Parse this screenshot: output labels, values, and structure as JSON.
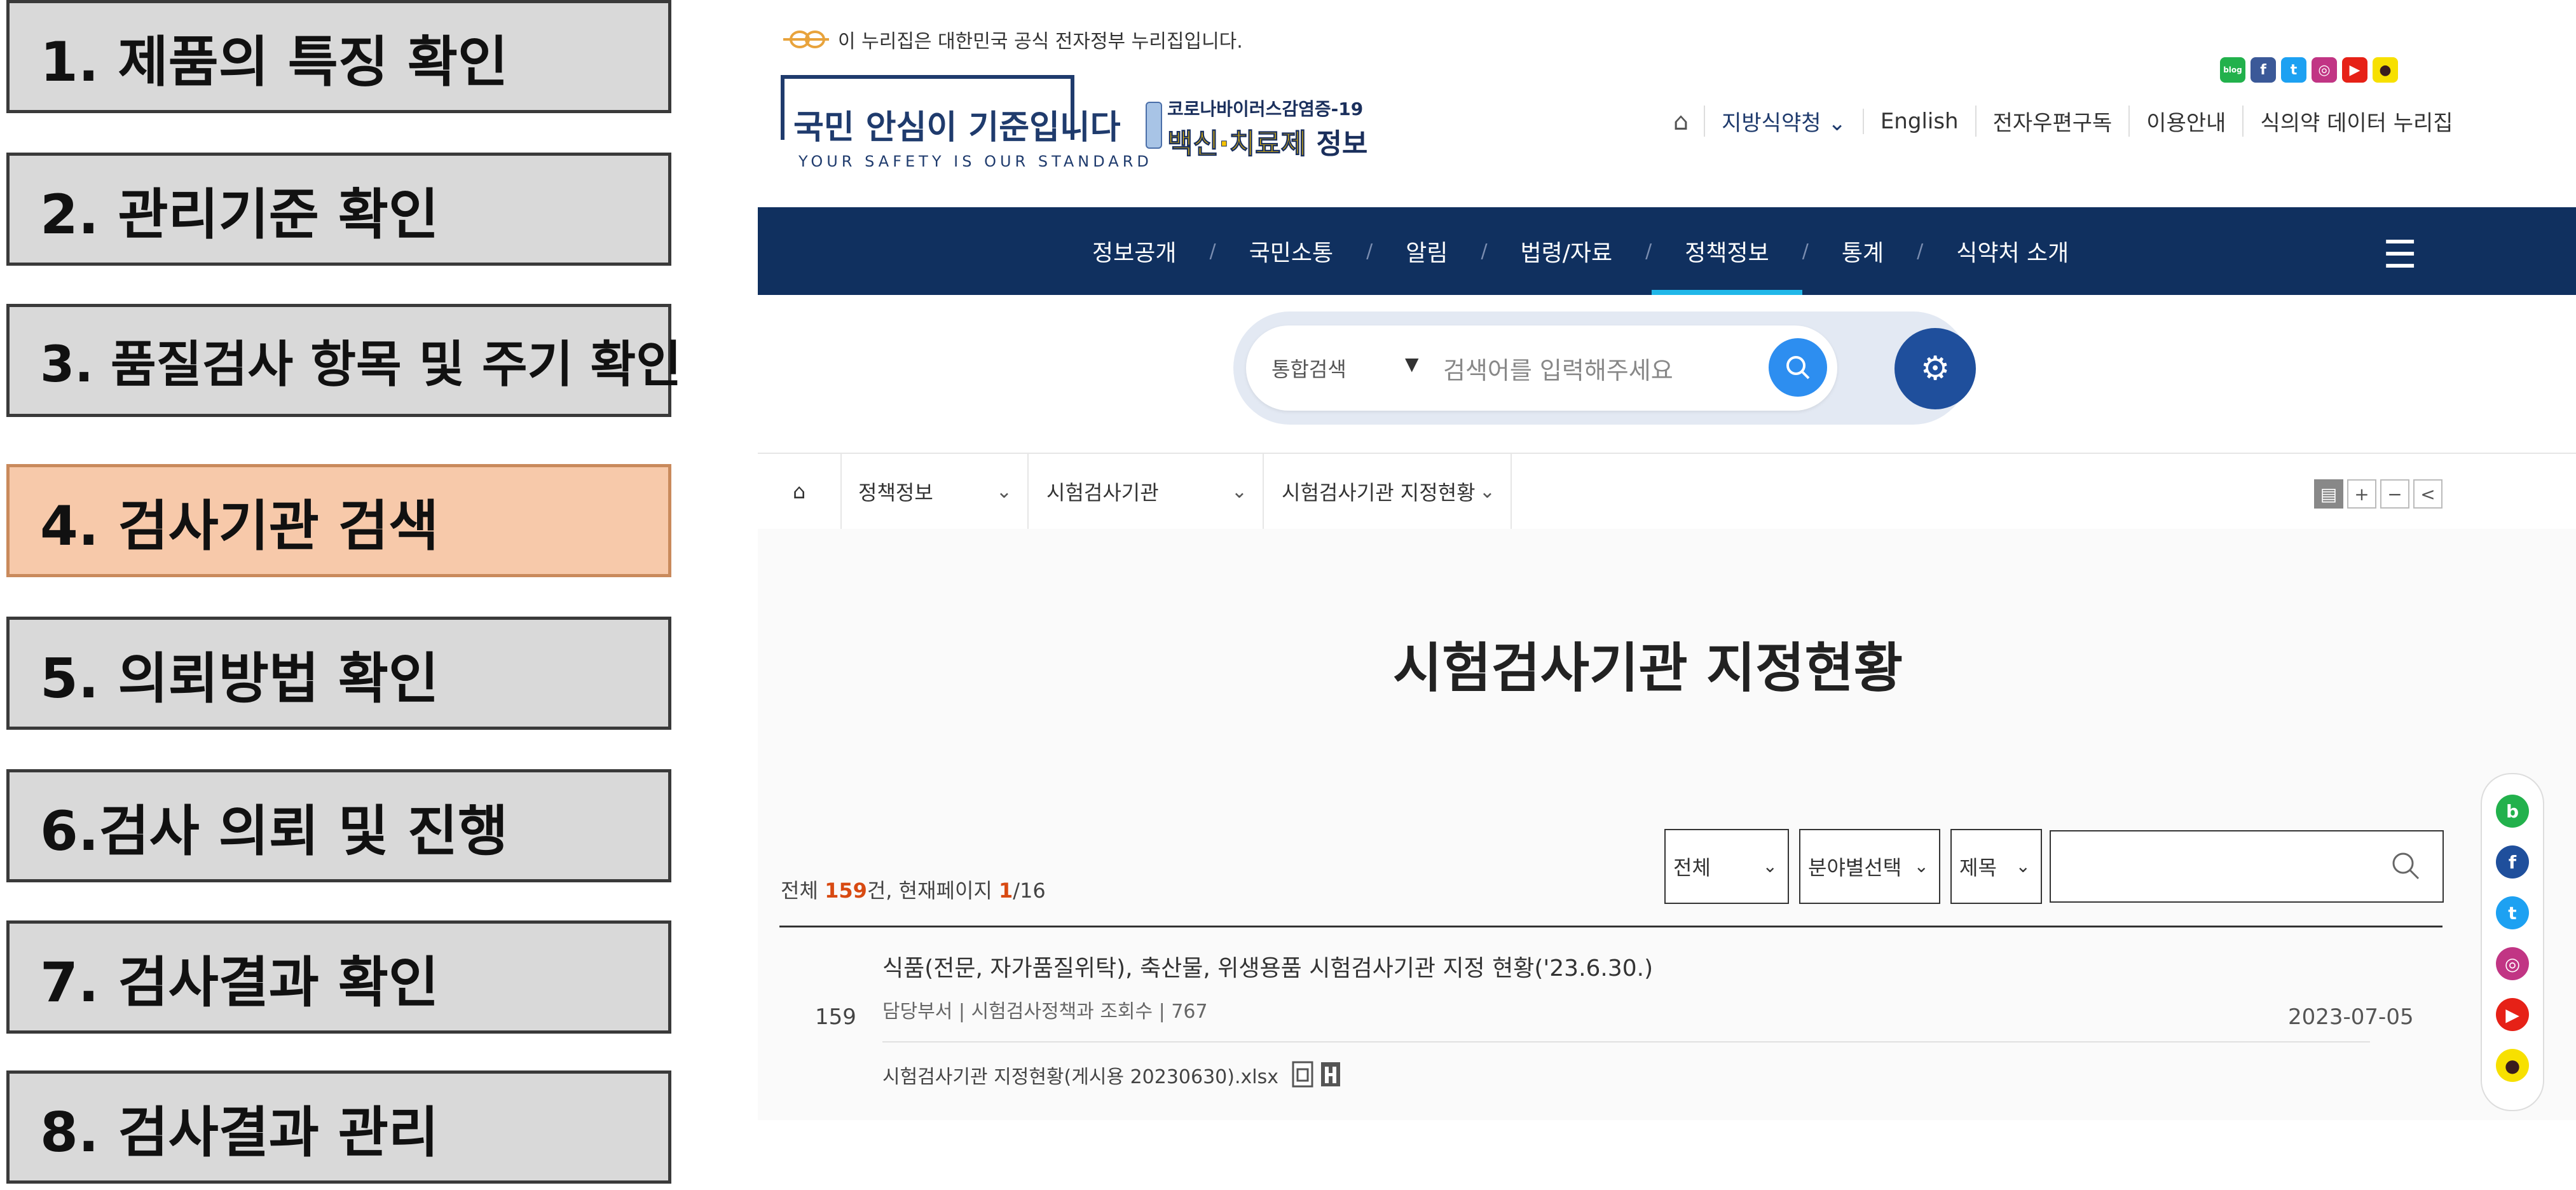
{
  "steps": [
    {
      "label": "1. 제품의 특징 확인"
    },
    {
      "label": "2. 관리기준 확인"
    },
    {
      "label": "3. 품질검사 항목 및 주기 확인"
    },
    {
      "label": "4. 검사기관 검색"
    },
    {
      "label": "5. 의뢰방법 확인"
    },
    {
      "label": "6.검사 의뢰 및 진행"
    },
    {
      "label": "7. 검사결과 확인"
    },
    {
      "label": "8. 검사결과 관리"
    }
  ],
  "active_step_index": 3,
  "site": {
    "gov_banner": "이 누리집은 대한민국 공식 전자정부 누리집입니다.",
    "logo": {
      "title": "국민 안심이 기준입니다",
      "subtitle": "YOUR SAFETY IS OUR STANDARD"
    },
    "covid": {
      "line1": "코로나바이러스감염증-19",
      "line2_highlight": "백신·치료제",
      "line2_plain": "정보"
    },
    "social_icons": [
      "blog-icon",
      "facebook-icon",
      "twitter-icon",
      "instagram-icon",
      "youtube-icon",
      "kakaotalk-icon"
    ],
    "util_nav": [
      "지방식약청",
      "English",
      "전자우편구독",
      "이용안내",
      "식의약 데이터 누리집"
    ],
    "main_nav": [
      "정보공개",
      "국민소통",
      "알림",
      "법령/자료",
      "정책정보",
      "통계",
      "식약처 소개"
    ],
    "main_nav_active": "정책정보",
    "search": {
      "scope": "통합검색",
      "placeholder": "검색어를 입력해주세요"
    },
    "breadcrumb": [
      "정책정보",
      "시험검사기관",
      "시험검사기관 지정현황"
    ],
    "page_title": "시험검사기관 지정현황",
    "filters": {
      "scope": "전체",
      "field": "분야별선택",
      "target": "제목"
    },
    "count": {
      "prefix": "전체 ",
      "total": "159",
      "mid": "건, 현재페이지 ",
      "page": "1",
      "pages": "/16"
    },
    "post": {
      "number": "159",
      "title": "식품(전문, 자가품질위탁), 축산물, 위생용품 시험검사기관 지정 현황('23.6.30.)",
      "meta": "담당부서 | 시험검사정책과    조회수 | 767",
      "file": "시험검사기관 지정현황(게시용 20230630).xlsx",
      "date": "2023-07-05"
    },
    "quick_icons": [
      "blog-icon",
      "facebook-icon",
      "twitter-icon",
      "instagram-icon",
      "youtube-icon",
      "kakaotalk-icon"
    ]
  },
  "colors": {
    "nav_bg": "#10305f",
    "active_step": "#f7c9aa",
    "step_bg": "#d9d9d9",
    "accent_underline": "#21b7e8",
    "count_highlight": "#d84a12"
  }
}
